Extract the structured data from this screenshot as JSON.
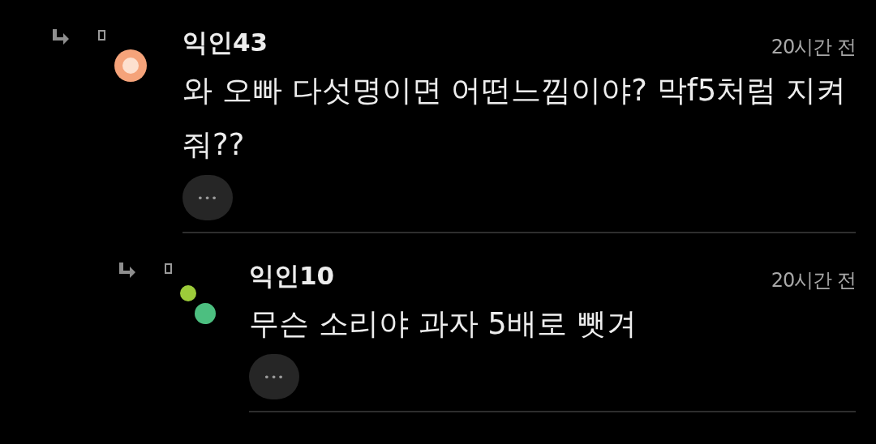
{
  "comments": [
    {
      "author": "익인43",
      "time": "20시간 전",
      "text": "와 오빠 다섯명이면 어떤느낌이야? 막f5처럼 지켜줘??",
      "more": "•••",
      "avatar": {
        "kind": "ring",
        "color": "#f5a37a"
      },
      "children": [
        {
          "author": "익인10",
          "time": "20시간 전",
          "text": "무슨 소리야 과자 5배로 뺏겨",
          "more": "•••",
          "avatar": {
            "kind": "dots",
            "color": "#4cbf80"
          }
        }
      ]
    }
  ]
}
